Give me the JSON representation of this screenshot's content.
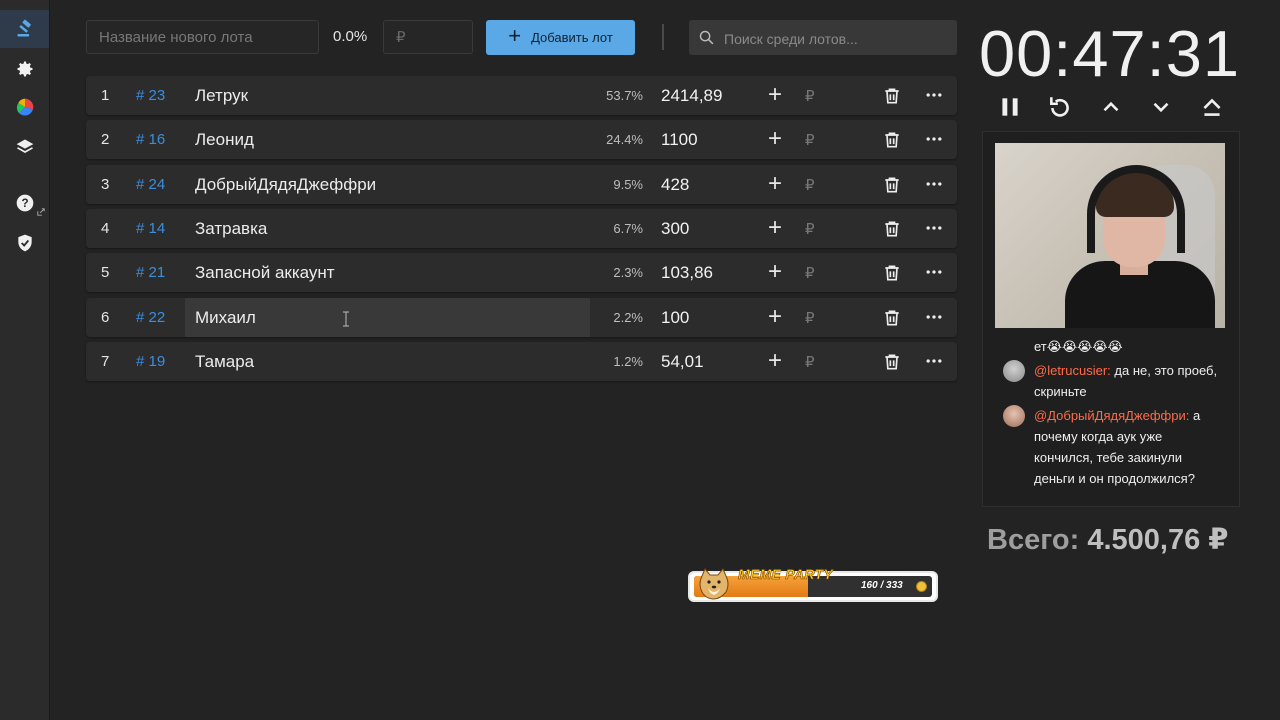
{
  "sidebar": {
    "items": [
      "auction-icon",
      "gear-icon",
      "pie-chart-icon",
      "layers-icon",
      "help-icon",
      "shield-check-icon"
    ]
  },
  "toolbar": {
    "lot_name_placeholder": "Название нового лота",
    "percent": "0.0%",
    "amount_placeholder": "₽",
    "add_lot_label": "Добавить лот",
    "search_placeholder": "Поиск среди лотов..."
  },
  "lots": [
    {
      "index": "1",
      "id": "# 23",
      "name": "Летрук",
      "percent": "53.7%",
      "amount": "2414,89"
    },
    {
      "index": "2",
      "id": "# 16",
      "name": "Леонид",
      "percent": "24.4%",
      "amount": "1100"
    },
    {
      "index": "3",
      "id": "# 24",
      "name": "ДобрыйДядяДжеффри",
      "percent": "9.5%",
      "amount": "428"
    },
    {
      "index": "4",
      "id": "# 14",
      "name": "Затравка",
      "percent": "6.7%",
      "amount": "300"
    },
    {
      "index": "5",
      "id": "# 21",
      "name": "Запасной аккаунт",
      "percent": "2.3%",
      "amount": "103,86"
    },
    {
      "index": "6",
      "id": "# 22",
      "name": "Михаил",
      "percent": "2.2%",
      "amount": "100"
    },
    {
      "index": "7",
      "id": "# 19",
      "name": "Тамара",
      "percent": "1.2%",
      "amount": "54,01"
    }
  ],
  "row_actions": {
    "add_symbol": "+",
    "currency_symbol": "₽"
  },
  "timer": {
    "value": "00:47:31",
    "controls": [
      "pause-icon",
      "reset-icon",
      "chevron-up-icon",
      "chevron-down-icon",
      "eject-icon"
    ]
  },
  "chat": {
    "messages": [
      {
        "author": "",
        "text": "ет😭😭😭😭😭"
      },
      {
        "author": "@letrucusier:",
        "text": " да не, это проеб, скриньте"
      },
      {
        "author": "@ДобрыйДядяДжеффри:",
        "text": " а почему когда аук уже кончился, тебе закинули деньги и он продолжился?"
      }
    ]
  },
  "total": {
    "label": "Всего:",
    "value": "4.500,76 ₽"
  },
  "meme_party": {
    "title": "MEME PARTY",
    "count": "160 / 333",
    "progress": 0.48
  },
  "colors": {
    "accent": "#5aa9e6",
    "id_link": "#3c8dde",
    "mention": "#ff6b4a",
    "background": "#232323",
    "row": "#2c2c2c"
  }
}
